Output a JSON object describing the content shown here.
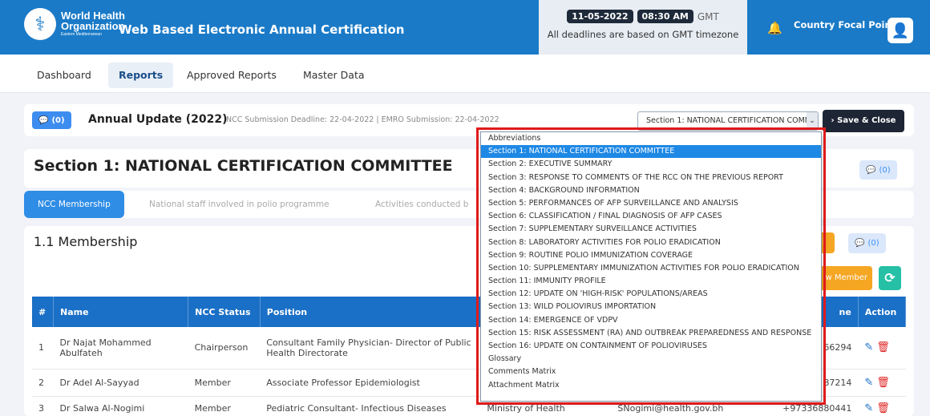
{
  "header": {
    "org_line1": "World Health",
    "org_line2": "Organization",
    "org_line3": "Eastern Mediterranean",
    "app_title": "Web Based Electronic Annual Certification",
    "date": "11-05-2022",
    "time": "08:30 AM",
    "timezone": "GMT",
    "deadline_note": "All deadlines are based on GMT timezone",
    "user_role": "Country Focal Point"
  },
  "nav": [
    {
      "label": "Dashboard"
    },
    {
      "label": "Reports"
    },
    {
      "label": "Approved Reports"
    },
    {
      "label": "Master Data"
    }
  ],
  "update_bar": {
    "comments_count": "(0)",
    "title": "Annual Update (2022)",
    "deadline": "NCC Submission Deadline: 22-04-2022 | EMRO Submission: 22-04-2022",
    "selected_section": "Section 1: NATIONAL CERTIFICATION COMMITTEE",
    "save_label": "Save & Close"
  },
  "section": {
    "title": "Section 1: NATIONAL CERTIFICATION COMMITTEE",
    "comments_count": "(0)"
  },
  "tabs": [
    {
      "label": "NCC Membership"
    },
    {
      "label": "National staff involved in polio programme"
    },
    {
      "label": "Activities conducted b"
    }
  ],
  "membership": {
    "title": "1.1 Membership",
    "comments_count": "(0)",
    "add_label": "w Member",
    "columns": [
      "#",
      "Name",
      "NCC Status",
      "Position",
      "",
      "ne",
      "Action"
    ],
    "rows": [
      {
        "num": "1",
        "name": "Dr Najat Mohammed Abulfateh",
        "status": "Chairperson",
        "position": "Consultant Family Physician- Director of Public Health Directorate",
        "org": "",
        "email": "",
        "phone": "66294"
      },
      {
        "num": "2",
        "name": "Dr Adel Al-Sayyad",
        "status": "Member",
        "position": "Associate Professor Epidemiologist",
        "org": "",
        "email": "",
        "phone": "87214"
      },
      {
        "num": "3",
        "name": "Dr Salwa Al-Nogimi",
        "status": "Member",
        "position": "Pediatric Consultant- Infectious Diseases",
        "org": "Ministry of Health",
        "email": "SNogimi@health.gov.bh",
        "phone": "+97336880441"
      }
    ]
  },
  "dropdown_options": [
    "Abbreviations",
    "Section 1: NATIONAL CERTIFICATION COMMITTEE",
    "Section 2: EXECUTIVE SUMMARY",
    "Section 3: RESPONSE TO COMMENTS OF THE RCC ON THE PREVIOUS REPORT",
    "Section 4: BACKGROUND INFORMATION",
    "Section 5: PERFORMANCES OF AFP SURVEILLANCE AND ANALYSIS",
    "Section 6: CLASSIFICATION / FINAL DIAGNOSIS OF AFP CASES",
    "Section 7: SUPPLEMENTARY SURVEILLANCE ACTIVITIES",
    "Section 8: LABORATORY ACTIVITIES FOR POLIO ERADICATION",
    "Section 9: ROUTINE POLIO IMMUNIZATION COVERAGE",
    "Section 10: SUPPLEMENTARY IMMUNIZATION ACTIVITIES FOR POLIO ERADICATION",
    "Section 11: IMMUNITY PROFILE",
    "Section 12: UPDATE ON 'HIGH-RISK' POPULATIONS/AREAS",
    "Section 13: WILD POLIOVIRUS IMPORTATION",
    "Section 14: EMERGENCE OF VDPV",
    "Section 15: RISK ASSESSMENT (RA) AND OUTBREAK PREPAREDNESS AND RESPONSE",
    "Section 16: UPDATE ON CONTAINMENT OF POLIOVIRUSES",
    "Glossary",
    "Comments Matrix",
    "Attachment Matrix"
  ],
  "colors": {
    "header_blue": "#1a7ac7",
    "table_header": "#1a6fc6",
    "selected_option": "#1e88e5",
    "highlight_red": "#e01a1a",
    "warning_orange": "#f5a623",
    "teal": "#25c0a6"
  }
}
